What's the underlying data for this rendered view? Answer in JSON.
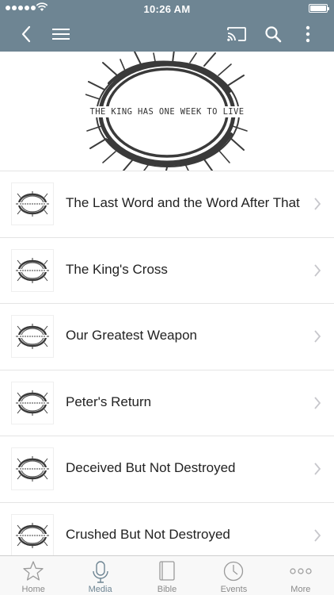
{
  "status_bar": {
    "time": "10:26 AM"
  },
  "hero": {
    "caption": "THE KING HAS ONE WEEK TO LIVE"
  },
  "sermons": [
    {
      "title": "The Last Word and the Word After That"
    },
    {
      "title": "The King's Cross"
    },
    {
      "title": "Our Greatest Weapon"
    },
    {
      "title": "Peter's Return"
    },
    {
      "title": "Deceived But Not Destroyed"
    },
    {
      "title": "Crushed But Not Destroyed"
    }
  ],
  "tabbar": {
    "home": "Home",
    "media": "Media",
    "bible": "Bible",
    "events": "Events",
    "more": "More",
    "active": "media"
  },
  "colors": {
    "header": "#6e8593",
    "active_tab": "#6e8593"
  }
}
